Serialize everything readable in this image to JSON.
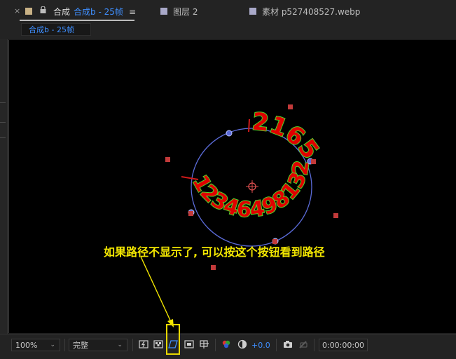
{
  "tabs": {
    "close_glyph": "×",
    "comp_tab": {
      "label": "合成",
      "name": "合成b - 25帧",
      "swatch": "#c9b286"
    },
    "menu_glyph": "≡",
    "layer_tab": {
      "label": "图层 2",
      "swatch": "#a9a9c9"
    },
    "footage_tab": {
      "label": "素材 p527408527.webp",
      "swatch": "#a9a9c9"
    },
    "subtab": "合成b - 25帧"
  },
  "viewer": {
    "path_text_top": "2165",
    "path_text_bottom": "123464981321",
    "annotation": "如果路径不显示了, 可以按这个按钮看到路径"
  },
  "toolbar": {
    "zoom": "100%",
    "resolution": "完整",
    "exposure": "+0.0",
    "timecode": "0:00:00:00"
  },
  "colors": {
    "accent_blue": "#3f8fff",
    "annotation_yellow": "#f2e600",
    "path_text_fill": "#e00000",
    "path_text_stroke": "#4fd62a",
    "mask_path": "#5b6bd8"
  }
}
